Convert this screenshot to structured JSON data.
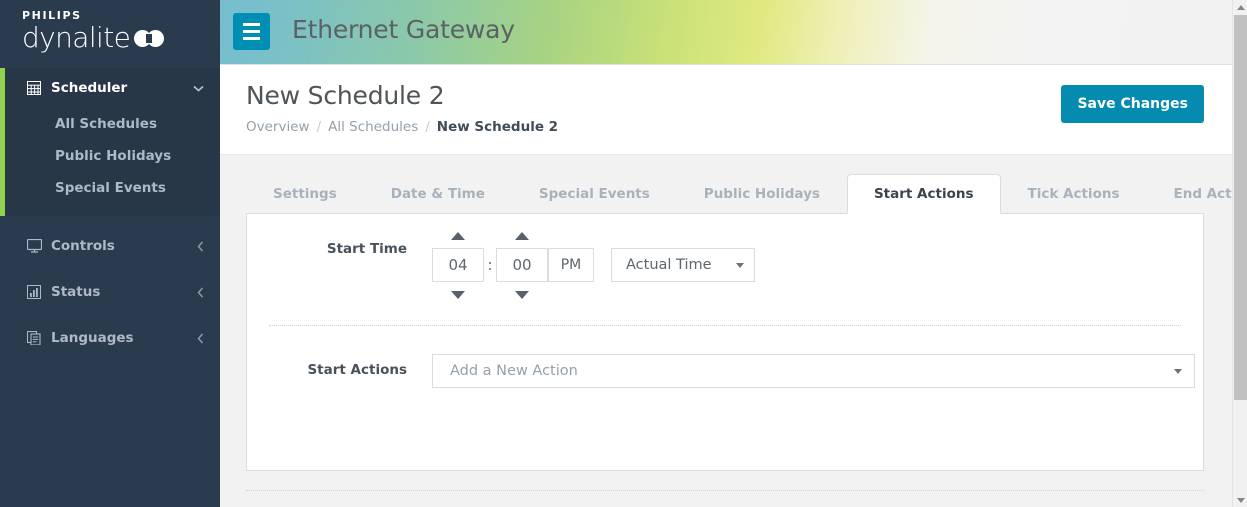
{
  "sidebar": {
    "logo": {
      "brand": "PHILIPS",
      "product": "dynalite",
      "mark_icon": "dynalite-logo-mark"
    },
    "groups": [
      {
        "label": "Scheduler",
        "icon": "grid-icon",
        "caret_icon": "chevron-down-icon",
        "expanded": true,
        "items": [
          {
            "label": "All Schedules"
          },
          {
            "label": "Public Holidays"
          },
          {
            "label": "Special Events"
          }
        ]
      },
      {
        "label": "Controls",
        "icon": "monitor-icon",
        "caret_icon": "chevron-left-icon",
        "expanded": false
      },
      {
        "label": "Status",
        "icon": "bar-chart-icon",
        "caret_icon": "chevron-left-icon",
        "expanded": false
      },
      {
        "label": "Languages",
        "icon": "document-icon",
        "caret_icon": "chevron-left-icon",
        "expanded": false
      }
    ],
    "accent_color": "#92d050",
    "background_color": "#2b3b4e"
  },
  "header": {
    "menu_toggle_icon": "hamburger-icon",
    "title": "Ethernet Gateway",
    "accent_color": "#008fb4"
  },
  "page": {
    "title": "New Schedule 2",
    "breadcrumb": [
      {
        "label": "Overview",
        "current": false
      },
      {
        "label": "All Schedules",
        "current": false
      },
      {
        "label": "New Schedule 2",
        "current": true
      }
    ],
    "breadcrumb_separator": "/",
    "save_button": {
      "label": "Save Changes",
      "color": "#058bb0"
    }
  },
  "tabs": [
    {
      "label": "Settings",
      "active": false
    },
    {
      "label": "Date & Time",
      "active": false
    },
    {
      "label": "Special Events",
      "active": false
    },
    {
      "label": "Public Holidays",
      "active": false
    },
    {
      "label": "Start Actions",
      "active": true
    },
    {
      "label": "Tick Actions",
      "active": false
    },
    {
      "label": "End Actions",
      "active": false
    }
  ],
  "form": {
    "start_time": {
      "label": "Start Time",
      "hour": "04",
      "separator": ":",
      "minute": "00",
      "meridiem": "PM",
      "hour_up_icon": "chevron-up-icon",
      "hour_down_icon": "chevron-down-icon",
      "minute_up_icon": "chevron-up-icon",
      "minute_down_icon": "chevron-down-icon",
      "mode": {
        "value": "Actual Time",
        "caret_icon": "chevron-down-icon"
      }
    },
    "start_actions": {
      "label": "Start Actions",
      "select": {
        "value": "Add a New Action",
        "caret_icon": "chevron-down-icon"
      }
    }
  },
  "scrollbar": {
    "up_icon": "scroll-up-arrow-icon",
    "down_icon": "scroll-down-arrow-icon"
  }
}
